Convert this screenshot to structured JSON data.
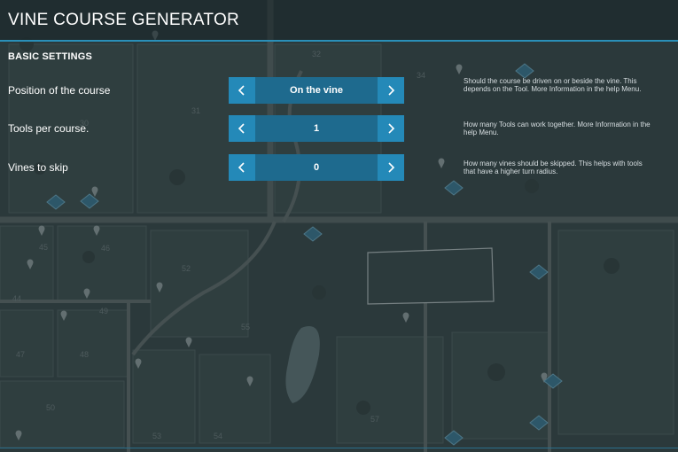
{
  "window": {
    "title": "VINE COURSE GENERATOR"
  },
  "section": {
    "title": "BASIC SETTINGS"
  },
  "settings": [
    {
      "label": "Position of the course",
      "value": "On the vine",
      "help": "Should the course be driven on or beside the vine. This depends on the Tool. More Information in the help Menu."
    },
    {
      "label": "Tools per course.",
      "value": "1",
      "help": "How many Tools can work together. More Information in the help Menu."
    },
    {
      "label": "Vines to skip",
      "value": "0",
      "help": "How many vines should be skipped. This helps with tools that have a higher turn radius."
    }
  ],
  "map": {
    "field_numbers": [
      "31",
      "30",
      "32",
      "34",
      "45",
      "46",
      "52",
      "44",
      "49",
      "47",
      "48",
      "55",
      "50",
      "53",
      "54",
      "57"
    ]
  },
  "colors": {
    "accent": "#2489b8",
    "selector_bg": "#1e6a8e",
    "header_line": "#2a8fb8",
    "text": "#ffffff",
    "help_text": "#d8dfe2",
    "map_bg": "#2f3d3f"
  },
  "icons": {
    "arrow_left": "chevron-left-icon",
    "arrow_right": "chevron-right-icon",
    "map_marker": "map-pin-icon",
    "map_station": "selling-station-icon"
  }
}
